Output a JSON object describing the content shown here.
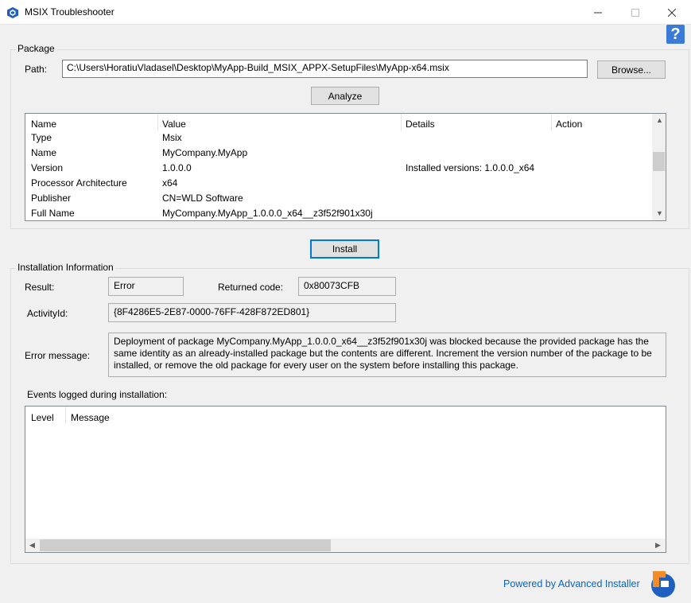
{
  "window": {
    "title": "MSIX Troubleshooter",
    "help_glyph": "?"
  },
  "package": {
    "group_label": "Package",
    "path_label": "Path:",
    "path_value": "C:\\Users\\HoratiuVladasel\\Desktop\\MyApp-Build_MSIX_APPX-SetupFiles\\MyApp-x64.msix",
    "browse_label": "Browse...",
    "analyze_label": "Analyze",
    "columns": [
      "Name",
      "Value",
      "Details",
      "Action"
    ],
    "rows": [
      {
        "name": "Type",
        "value": "Msix",
        "details": "",
        "action": ""
      },
      {
        "name": "Name",
        "value": "MyCompany.MyApp",
        "details": "",
        "action": ""
      },
      {
        "name": "Version",
        "value": "1.0.0.0",
        "details": "Installed versions: 1.0.0.0_x64",
        "action": ""
      },
      {
        "name": "Processor Architecture",
        "value": "x64",
        "details": "",
        "action": ""
      },
      {
        "name": "Publisher",
        "value": "CN=WLD Software",
        "details": "",
        "action": ""
      },
      {
        "name": "Full Name",
        "value": "MyCompany.MyApp_1.0.0.0_x64__z3f52f901x30j",
        "details": "",
        "action": ""
      }
    ]
  },
  "install_label": "Install",
  "installation": {
    "group_label": "Installation Information",
    "result_label": "Result:",
    "result_value": "Error",
    "returned_code_label": "Returned code:",
    "returned_code_value": "0x80073CFB",
    "activity_label": "ActivityId:",
    "activity_value": "{8F4286E5-2E87-0000-76FF-428F872ED801}",
    "error_label": "Error message:",
    "error_value": "Deployment of package MyCompany.MyApp_1.0.0.0_x64__z3f52f901x30j was blocked because the provided package has the same identity as an already-installed package but the contents are different. Increment the version number of the package to be installed, or remove the old package for every user on the system before installing this package.",
    "events_label": "Events logged during installation:",
    "events_columns": [
      "Level",
      "Message"
    ]
  },
  "footer": {
    "powered_by": "Powered by Advanced Installer"
  },
  "colors": {
    "accent": "#0078d7",
    "link": "#0066cc",
    "help_icon": "#3b7ad6",
    "logo_orange": "#f28c28",
    "logo_blue": "#1f5fbf"
  }
}
